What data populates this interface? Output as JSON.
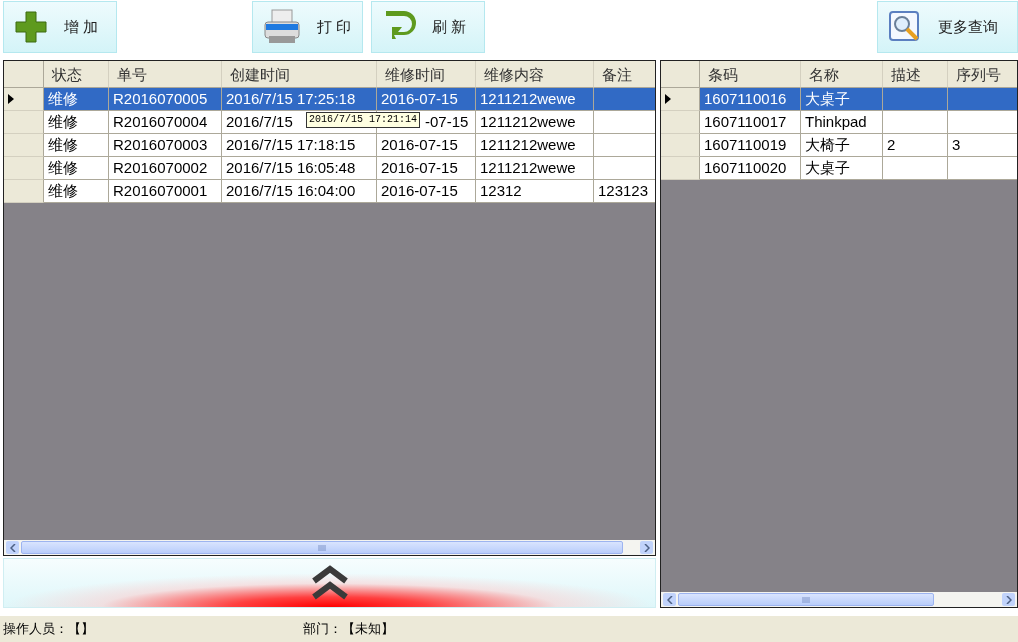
{
  "toolbar": {
    "left": [
      {
        "kind": "add",
        "label": "增 加"
      },
      {
        "kind": "print",
        "label": "打 印"
      },
      {
        "kind": "refresh",
        "label": "刷 新"
      }
    ],
    "right": [
      {
        "kind": "search",
        "label": "更多查询"
      }
    ]
  },
  "orders": {
    "columns": [
      "状态",
      "单号",
      "创建时间",
      "维修时间",
      "维修内容",
      "备注"
    ],
    "rows": [
      {
        "selected": true,
        "cells": [
          "维修",
          "R2016070005",
          "2016/7/15 17:25:18",
          "2016-07-15",
          "1211212wewe",
          ""
        ]
      },
      {
        "selected": false,
        "cells": [
          "维修",
          "R2016070004",
          "2016/7/15",
          "-07-15",
          "1211212wewe",
          ""
        ],
        "tooltip": "2016/7/15 17:21:14"
      },
      {
        "selected": false,
        "cells": [
          "维修",
          "R2016070003",
          "2016/7/15 17:18:15",
          "2016-07-15",
          "1211212wewe",
          ""
        ]
      },
      {
        "selected": false,
        "cells": [
          "维修",
          "R2016070002",
          "2016/7/15 16:05:48",
          "2016-07-15",
          "1211212wewe",
          ""
        ]
      },
      {
        "selected": false,
        "cells": [
          "维修",
          "R2016070001",
          "2016/7/15 16:04:00",
          "2016-07-15",
          "12312",
          "123123"
        ]
      }
    ]
  },
  "items": {
    "columns": [
      "条码",
      "名称",
      "描述",
      "序列号"
    ],
    "rows": [
      {
        "selected": true,
        "cells": [
          "1607110016",
          "大桌子",
          "",
          ""
        ]
      },
      {
        "selected": false,
        "cells": [
          "1607110017",
          "Thinkpad",
          "",
          ""
        ]
      },
      {
        "selected": false,
        "cells": [
          "1607110019",
          "大椅子",
          "2",
          "3"
        ]
      },
      {
        "selected": false,
        "cells": [
          "1607110020",
          "大桌子",
          "",
          ""
        ]
      }
    ]
  },
  "status_bar": [
    {
      "label": "操作人员：【】"
    },
    {
      "label": "部门：【未知】"
    }
  ]
}
